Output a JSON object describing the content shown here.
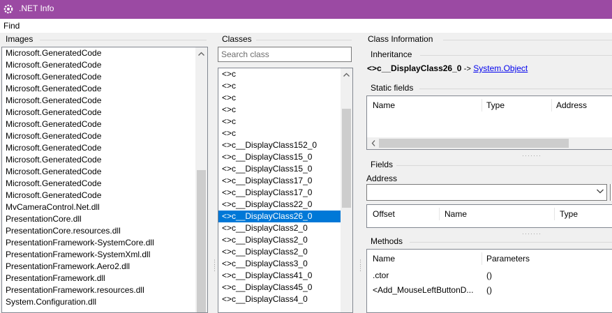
{
  "window": {
    "title": ".NET Info",
    "icon": "gear-icon",
    "titlebar_color": "#9b4aa3"
  },
  "menu": {
    "find_label": "Find"
  },
  "images": {
    "label": "Images",
    "items": [
      "Microsoft.GeneratedCode",
      "Microsoft.GeneratedCode",
      "Microsoft.GeneratedCode",
      "Microsoft.GeneratedCode",
      "Microsoft.GeneratedCode",
      "Microsoft.GeneratedCode",
      "Microsoft.GeneratedCode",
      "Microsoft.GeneratedCode",
      "Microsoft.GeneratedCode",
      "Microsoft.GeneratedCode",
      "Microsoft.GeneratedCode",
      "Microsoft.GeneratedCode",
      "Microsoft.GeneratedCode",
      "MvCameraControl.Net.dll",
      "PresentationCore.dll",
      "PresentationCore.resources.dll",
      "PresentationFramework-SystemCore.dll",
      "PresentationFramework-SystemXml.dll",
      "PresentationFramework.Aero2.dll",
      "PresentationFramework.dll",
      "PresentationFramework.resources.dll",
      "System.Configuration.dll"
    ]
  },
  "classes": {
    "label": "Classes",
    "search_placeholder": "Search class",
    "items": [
      "<>c",
      "<>c",
      "<>c",
      "<>c",
      "<>c",
      "<>c",
      "<>c__DisplayClass152_0",
      "<>c__DisplayClass15_0",
      "<>c__DisplayClass15_0",
      "<>c__DisplayClass17_0",
      "<>c__DisplayClass17_0",
      "<>c__DisplayClass22_0",
      "<>c__DisplayClass26_0",
      "<>c__DisplayClass2_0",
      "<>c__DisplayClass2_0",
      "<>c__DisplayClass2_0",
      "<>c__DisplayClass3_0",
      "<>c__DisplayClass41_0",
      "<>c__DisplayClass45_0",
      "<>c__DisplayClass4_0"
    ],
    "selected_index": 12
  },
  "class_info": {
    "label": "Class Information",
    "inheritance": {
      "label": "Inheritance",
      "class_name": "<>c__DisplayClass26_0",
      "arrow": "->",
      "base_link": "System.Object"
    },
    "static_fields": {
      "label": "Static fields",
      "columns": [
        "Name",
        "Type",
        "Address"
      ]
    },
    "fields": {
      "label": "Fields",
      "address_label": "Address",
      "address_value": "",
      "columns": [
        "Offset",
        "Name",
        "Type"
      ]
    },
    "methods": {
      "label": "Methods",
      "columns": [
        "Name",
        "Parameters"
      ],
      "rows": [
        {
          "name": ".ctor",
          "params": "()"
        },
        {
          "name": "<Add_MouseLeftButtonD...",
          "params": "()"
        }
      ]
    }
  },
  "colors": {
    "selection": "#0078d7",
    "link": "#0000ee"
  }
}
